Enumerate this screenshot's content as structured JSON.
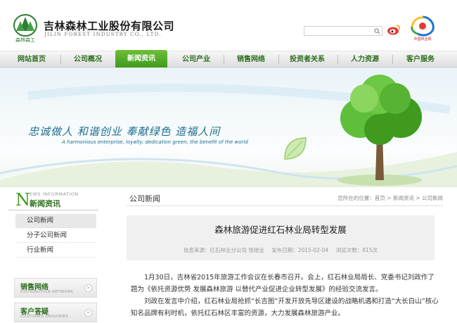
{
  "header": {
    "company_cn": "吉林森林工业股份有限公司",
    "company_en": "JILIN FOREST INDUSTRY CO., LTD.",
    "logo_sub": "森林森工",
    "partner_label": "中国林业网",
    "brand_color": "#3f9a1e"
  },
  "nav": {
    "items": [
      {
        "label": "网站首页"
      },
      {
        "label": "公司概况"
      },
      {
        "label": "新闻资讯",
        "active": true
      },
      {
        "label": "公司产业"
      },
      {
        "label": "销售网络"
      },
      {
        "label": "投资者关系"
      },
      {
        "label": "人力资源"
      },
      {
        "label": "客户服务"
      }
    ]
  },
  "banner": {
    "slogan": "忠诚做人 和谐创业 奉献绿色 造福人间",
    "slogan_en": "A harmonious enterprise, loyalty, dedication green, the benefit of the world"
  },
  "sidebar": {
    "head_initial": "N",
    "head_en": "EWS INFORMATION",
    "head_cn": "新闻资讯",
    "items": [
      {
        "label": "公司新闻",
        "active": true
      },
      {
        "label": "分子公司新闻"
      },
      {
        "label": "行业新闻"
      }
    ],
    "boxes": [
      {
        "title": "销售网络",
        "sub": "DISTRIBUTION NETWORK",
        "arrow": "»"
      },
      {
        "title": "客户答疑",
        "sub": "CUSTOMER ENQUIRIES",
        "arrow": "»"
      }
    ]
  },
  "content": {
    "section_title": "公司新闻",
    "breadcrumb": "您所在的位置：首页 > 新闻资讯 > 公司新闻",
    "article_title": "森林旅游促进红石林业局转型发展",
    "meta": {
      "source": "信息来源：红石林业分公司 张继业",
      "date": "发布日期：2015-02-04",
      "views": "浏览次数：815次"
    },
    "paragraphs": [
      "1月30日，吉林省2015年旅游工作会议在长春市召开。会上，红石林业局局长、党委书记刘政作了题为《依托资源优势 发展森林旅游 以替代产业促进企业转型发展》的经验交流发言。",
      "刘政在发言中介绍，红石林业局抢抓“长吉图”开发开放先导区建设的战略机遇和打造“大长白山”核心知名品牌有利时机，依托红石林区丰富的资源，大力发展森林旅游产业。"
    ]
  }
}
